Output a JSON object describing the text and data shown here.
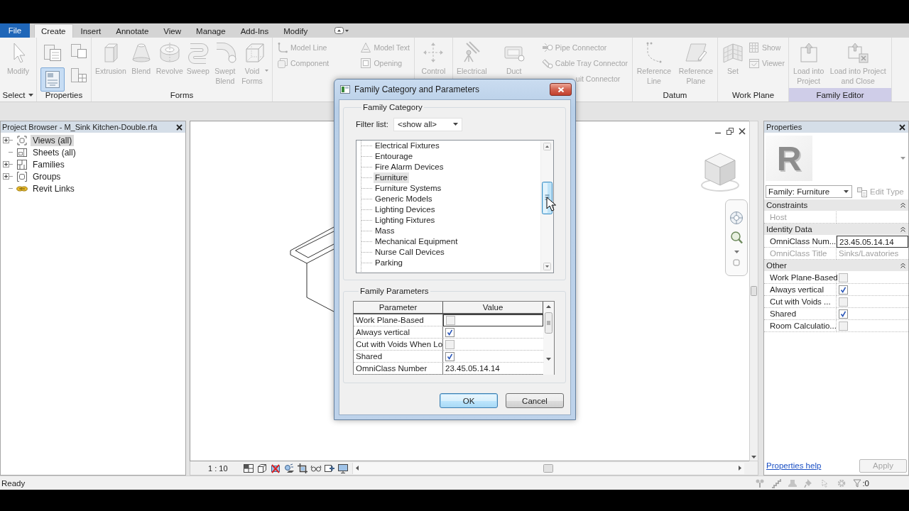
{
  "ribbon": {
    "tabs": [
      {
        "label": "File",
        "kind": "application",
        "selected": false
      },
      {
        "label": "Create",
        "kind": "tab",
        "selected": true
      },
      {
        "label": "Insert",
        "kind": "tab",
        "selected": false
      },
      {
        "label": "Annotate",
        "kind": "tab",
        "selected": false
      },
      {
        "label": "View",
        "kind": "tab",
        "selected": false
      },
      {
        "label": "Manage",
        "kind": "tab",
        "selected": false
      },
      {
        "label": "Add-Ins",
        "kind": "tab",
        "selected": false
      },
      {
        "label": "Modify",
        "kind": "tab",
        "selected": false
      }
    ],
    "panels": [
      {
        "label": "Select",
        "dropdown": true,
        "items": [
          {
            "kind": "large",
            "label": "Modify",
            "disabled": true
          }
        ]
      },
      {
        "label": "Properties",
        "items": [
          {
            "kind": "stack",
            "buttons": [
              {
                "kind": "icon",
                "selected": false
              },
              {
                "kind": "icon",
                "selected": true
              }
            ]
          },
          {
            "kind": "stack",
            "buttons": [
              {
                "kind": "icon",
                "selected": false
              },
              {
                "kind": "icon",
                "selected": false
              }
            ]
          }
        ]
      },
      {
        "label": "Forms",
        "items": [
          {
            "kind": "large",
            "label": "Extrusion",
            "disabled": true
          },
          {
            "kind": "large",
            "label": "Blend",
            "disabled": true
          },
          {
            "kind": "large",
            "label": "Revolve",
            "disabled": true
          },
          {
            "kind": "large",
            "label": "Sweep",
            "disabled": true
          },
          {
            "kind": "large",
            "label": "Swept Blend",
            "disabled": true
          },
          {
            "kind": "large",
            "label": "Void Forms",
            "disabled": true,
            "dropdown": true
          }
        ]
      },
      {
        "items": [
          {
            "kind": "stack",
            "buttons": [
              {
                "kind": "small",
                "label": "Model Line",
                "disabled": true
              },
              {
                "kind": "small",
                "label": "Component",
                "disabled": true
              }
            ]
          },
          {
            "kind": "stack",
            "buttons": [
              {
                "kind": "small",
                "label": "Model Text",
                "disabled": true
              },
              {
                "kind": "small",
                "label": "Opening",
                "disabled": true
              }
            ]
          }
        ]
      },
      {
        "items": [
          {
            "kind": "large",
            "label": "Control",
            "disabled": true
          }
        ]
      },
      {
        "items": [
          {
            "kind": "large",
            "label": "Electrical",
            "disabled": true
          },
          {
            "kind": "large",
            "label": "Duct",
            "disabled": true
          },
          {
            "kind": "stack",
            "buttons": [
              {
                "kind": "small",
                "label": "Pipe Connector",
                "disabled": true
              },
              {
                "kind": "small",
                "label": "Cable Tray Connector",
                "disabled": true
              },
              {
                "kind": "partial",
                "label": "uit Connector",
                "disabled": true
              }
            ]
          }
        ]
      },
      {
        "label": "Datum",
        "items": [
          {
            "kind": "large",
            "label": "Reference Line",
            "disabled": true
          },
          {
            "kind": "large",
            "label": "Reference Plane",
            "disabled": true
          }
        ]
      },
      {
        "label": "Work Plane",
        "items": [
          {
            "kind": "large",
            "label": "Set",
            "disabled": true
          },
          {
            "kind": "stack",
            "buttons": [
              {
                "kind": "small",
                "label": "Show",
                "disabled": true
              },
              {
                "kind": "small",
                "label": "Viewer",
                "disabled": true
              }
            ]
          }
        ]
      },
      {
        "label": "Family Editor",
        "contextual": true,
        "items": [
          {
            "kind": "large",
            "label": "Load into Project",
            "disabled": true
          },
          {
            "kind": "large",
            "label": "Load into Project and Close",
            "disabled": true
          }
        ]
      }
    ]
  },
  "project_browser": {
    "title": "Project Browser - M_Sink Kitchen-Double.rfa",
    "items": [
      {
        "label": "Views (all)",
        "kind": "views",
        "expanded": false,
        "selected": true
      },
      {
        "label": "Sheets (all)",
        "kind": "sheets",
        "selected": false
      },
      {
        "label": "Families",
        "kind": "families",
        "expanded": false,
        "selected": false
      },
      {
        "label": "Groups",
        "kind": "groups",
        "expanded": false,
        "selected": false
      },
      {
        "label": "Revit Links",
        "kind": "links",
        "selected": false
      }
    ]
  },
  "view": {
    "scale": "1 : 10"
  },
  "properties": {
    "title": "Properties",
    "preview_logo": "R",
    "type_selector": "Family: Furniture",
    "edit_type": {
      "label": "Edit Type",
      "disabled": true
    },
    "sections": [
      {
        "title": "Constraints",
        "expanded": true,
        "rows": [
          {
            "label": "Host",
            "kind": "text",
            "disabled": true,
            "focused": false
          }
        ]
      },
      {
        "title": "Identity Data",
        "expanded": true,
        "rows": [
          {
            "label": "OmniClass Num...",
            "kind": "text",
            "value": "23.45.05.14.14",
            "disabled": false,
            "focused": true
          },
          {
            "label": "OmniClass Title",
            "kind": "text",
            "value": "Sinks/Lavatories",
            "disabled": true,
            "focused": false
          }
        ]
      },
      {
        "title": "Other",
        "expanded": true,
        "rows": [
          {
            "label": "Work Plane-Based",
            "kind": "checkbox",
            "checked": false,
            "disabled": false,
            "focused": false
          },
          {
            "label": "Always vertical",
            "kind": "checkbox",
            "checked": true,
            "disabled": false,
            "focused": false
          },
          {
            "label": "Cut with Voids ...",
            "kind": "checkbox",
            "checked": false,
            "disabled": false,
            "focused": false
          },
          {
            "label": "Shared",
            "kind": "checkbox",
            "checked": true,
            "disabled": false,
            "focused": false
          },
          {
            "label": "Room Calculatio...",
            "kind": "checkbox",
            "checked": false,
            "disabled": false,
            "focused": false
          }
        ]
      }
    ],
    "help_link": "Properties help",
    "apply": {
      "label": "Apply",
      "disabled": true
    }
  },
  "status_bar": {
    "text": "Ready",
    "filter_count": ":0"
  },
  "dialog": {
    "title": "Family Category and Parameters",
    "category_group": "Family Category",
    "filter_label": "Filter list:",
    "filter_value": "<show all>",
    "categories": [
      {
        "label": "Electrical Fixtures",
        "selected": false
      },
      {
        "label": "Entourage",
        "selected": false
      },
      {
        "label": "Fire Alarm Devices",
        "selected": false
      },
      {
        "label": "Furniture",
        "selected": true
      },
      {
        "label": "Furniture Systems",
        "selected": false
      },
      {
        "label": "Generic Models",
        "selected": false
      },
      {
        "label": "Lighting Devices",
        "selected": false
      },
      {
        "label": "Lighting Fixtures",
        "selected": false
      },
      {
        "label": "Mass",
        "selected": false
      },
      {
        "label": "Mechanical Equipment",
        "selected": false
      },
      {
        "label": "Nurse Call Devices",
        "selected": false
      },
      {
        "label": "Parking",
        "selected": false
      }
    ],
    "parameters_group": "Family Parameters",
    "columns": [
      "Parameter",
      "Value"
    ],
    "parameters": [
      {
        "name": "Work Plane-Based",
        "kind": "checkbox",
        "checked": false,
        "focused": true
      },
      {
        "name": "Always vertical",
        "kind": "checkbox",
        "checked": true,
        "focused": false
      },
      {
        "name": "Cut with Voids When Lo",
        "kind": "checkbox",
        "checked": false,
        "focused": false
      },
      {
        "name": "Shared",
        "kind": "checkbox",
        "checked": true,
        "focused": false
      },
      {
        "name": "OmniClass Number",
        "kind": "text",
        "value": "23.45.05.14.14",
        "focused": false
      }
    ],
    "buttons": [
      {
        "label": "OK",
        "default": true
      },
      {
        "label": "Cancel",
        "default": false
      }
    ]
  }
}
